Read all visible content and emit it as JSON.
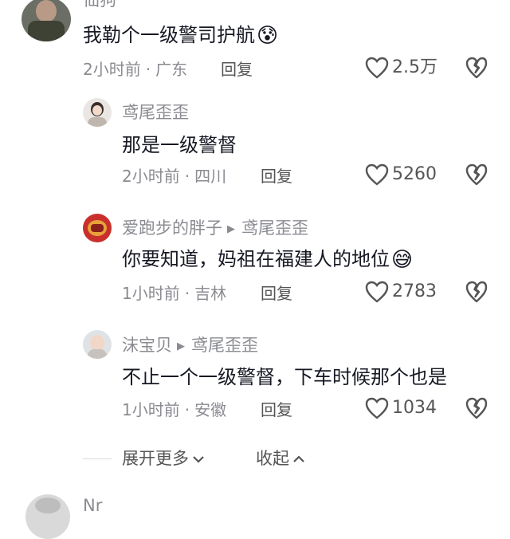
{
  "top_partial_username": "仙狗",
  "comments": [
    {
      "username": "",
      "content": "我勒个一级警司护航",
      "emoji": "😰",
      "time": "2小时前",
      "location": "广东",
      "reply_label": "回复",
      "likes": "2.5万"
    },
    {
      "username": "鸢尾歪歪",
      "content": "那是一级警督",
      "time": "2小时前",
      "location": "四川",
      "reply_label": "回复",
      "likes": "5260"
    },
    {
      "username": "爱跑步的胖子",
      "reply_to": "鸢尾歪歪",
      "content": "你要知道，妈祖在福建人的地位",
      "emoji": "😅",
      "time": "1小时前",
      "location": "吉林",
      "reply_label": "回复",
      "likes": "2783"
    },
    {
      "username": "沫宝贝",
      "reply_to": "鸢尾歪歪",
      "content": "不止一个一级警督，下车时候那个也是",
      "time": "1小时前",
      "location": "安徽",
      "reply_label": "回复",
      "likes": "1034"
    }
  ],
  "expand_more": "展开更多",
  "collapse": "收起",
  "bottom_partial_username": "Nr"
}
